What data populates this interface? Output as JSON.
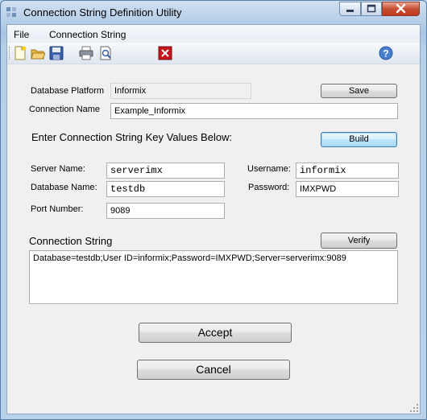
{
  "window": {
    "title": "Connection String Definition Utility"
  },
  "menu": {
    "items": [
      "File",
      "Connection String"
    ]
  },
  "toolbar": {
    "icons": [
      "new-icon",
      "open-icon",
      "save-icon",
      "print-icon",
      "print-preview-icon",
      "exit-icon",
      "help-icon"
    ]
  },
  "form": {
    "platform_label": "Database Platform",
    "platform_value": "Informix",
    "save_label": "Save",
    "connection_name_label": "Connection Name",
    "connection_name_value": "Example_Informix",
    "key_values_heading": "Enter Connection String Key Values Below:",
    "build_label": "Build",
    "server_label": "Server Name:",
    "server_value": "serverimx",
    "username_label": "Username:",
    "username_value": "informix",
    "database_label": "Database Name:",
    "database_value": "testdb",
    "password_label": "Password:",
    "password_value": "IMXPWD",
    "port_label": "Port Number:",
    "port_value": "9089",
    "connection_string_heading": "Connection String",
    "verify_label": "Verify",
    "connection_string_value": "Database=testdb;User ID=informix;Password=IMXPWD;Server=serverimx:9089",
    "accept_label": "Accept",
    "cancel_label": "Cancel"
  },
  "colors": {
    "frame": "#b9d1ea",
    "client": "#f0f0f0",
    "close_button": "#c74f34",
    "default_button": "#bee6fd"
  }
}
